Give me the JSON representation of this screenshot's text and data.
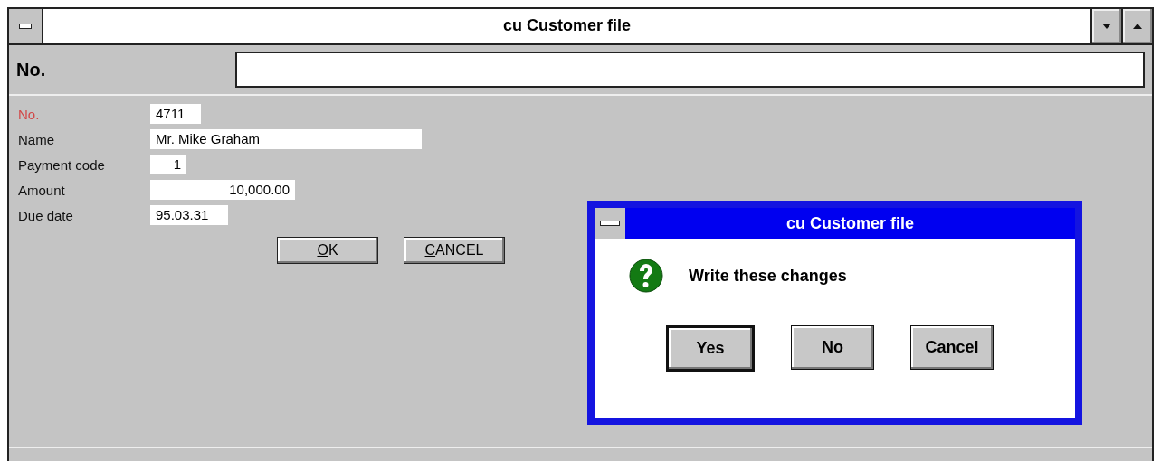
{
  "window": {
    "title": "cu Customer file"
  },
  "search": {
    "label": "No."
  },
  "form": {
    "fields": [
      {
        "label": "No.",
        "value": "4711",
        "highlighted": true,
        "kind": "text"
      },
      {
        "label": "Name",
        "value": "Mr. Mike Graham",
        "highlighted": false,
        "kind": "text"
      },
      {
        "label": "Payment code",
        "value": "1",
        "highlighted": false,
        "kind": "number"
      },
      {
        "label": "Amount",
        "value": "10,000.00",
        "highlighted": false,
        "kind": "number"
      },
      {
        "label": "Due date",
        "value": "95.03.31",
        "highlighted": false,
        "kind": "text"
      }
    ],
    "buttons": [
      {
        "label": "OK"
      },
      {
        "label": "CANCEL"
      }
    ]
  },
  "dialog": {
    "title": "cu Customer file",
    "message": "Write these changes",
    "buttons": [
      {
        "label": "Yes",
        "default": true
      },
      {
        "label": "No",
        "default": false
      },
      {
        "label": "Cancel",
        "default": false
      }
    ]
  }
}
